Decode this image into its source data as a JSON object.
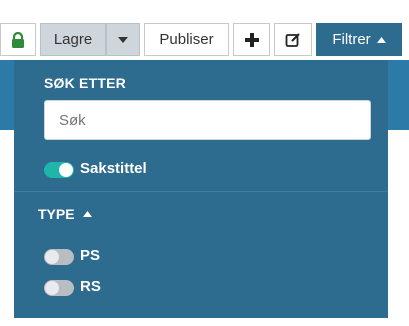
{
  "toolbar": {
    "lock_icon": "lock-icon",
    "save_label": "Lagre",
    "save_menu_icon": "caret-down-icon",
    "publish_label": "Publiser",
    "add_icon": "plus-icon",
    "edit_icon": "edit-icon",
    "filter_label": "Filtrer",
    "filter_icon": "caret-up-icon"
  },
  "filter_panel": {
    "search_section_title": "SØK ETTER",
    "search_placeholder": "Søk",
    "search_value": "",
    "title_toggle": {
      "label": "Sakstittel",
      "enabled": true
    },
    "type_section_title": "TYPE",
    "type_section_icon": "caret-up-icon",
    "type_options": [
      {
        "label": "PS",
        "enabled": false
      },
      {
        "label": "RS",
        "enabled": false
      }
    ]
  },
  "colors": {
    "panel": "#2d6b8f",
    "header_bar": "#2c7aa8",
    "toggle_on": "#1fb5a8",
    "toggle_off": "#b8bdc1",
    "lock_green": "#2e8b3c"
  }
}
